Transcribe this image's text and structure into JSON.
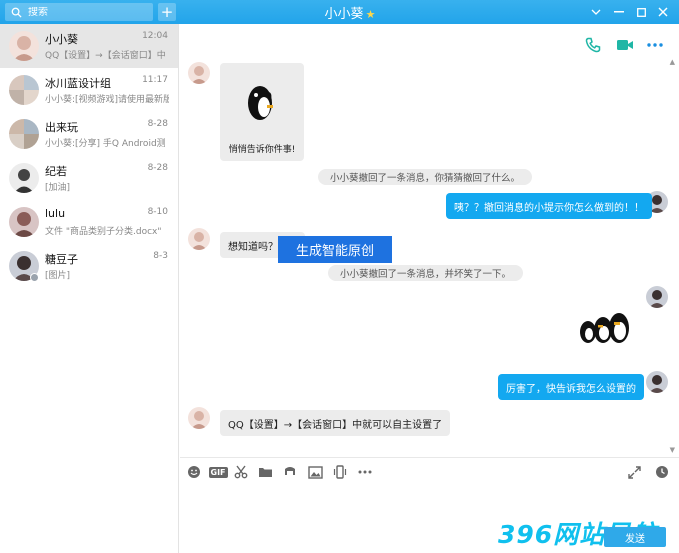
{
  "window": {
    "title": "小小葵",
    "search_placeholder": "搜索",
    "add_label": "+",
    "colors": {
      "titlebar": "#22a4ea",
      "accent": "#13a8f0"
    }
  },
  "contacts": [
    {
      "name": "小小葵",
      "time": "12:04",
      "preview": "QQ【设置】→【会话窗口】中"
    },
    {
      "name": "冰川蓝设计组",
      "time": "11:17",
      "preview": "小小葵:[视频游戏]请使用最新版"
    },
    {
      "name": "出来玩",
      "time": "8-28",
      "preview": "小小葵:[分享] 手Q Android测"
    },
    {
      "name": "纪若",
      "time": "8-28",
      "preview": "[加油]"
    },
    {
      "name": "lulu",
      "time": "8-10",
      "preview": "文件 \"商品类别子分类.docx\""
    },
    {
      "name": "糖豆子",
      "time": "8-3",
      "preview": "[图片]"
    }
  ],
  "messages": {
    "sticker_caption": "悄悄告诉你件事!",
    "sys_recall_1": "小小葵撤回了一条消息，你猜猜撤回了什么。",
    "out_1": "咦？？撤回消息的小提示你怎么做到的！！",
    "watermark": "生成智能原创",
    "in_1": "想知道吗？hhh",
    "sys_recall_2": "小小葵撤回了一条消息，并坏笑了一下。",
    "out_2": "厉害了，快告诉我怎么设置的",
    "in_2": "QQ【设置】→【会话窗口】中就可以自主设置了"
  },
  "toolbar": {
    "gif_label": "GIF"
  },
  "footer": {
    "brand": "396网站导航",
    "send_label": "发送"
  },
  "icons": [
    "search-icon",
    "phone-icon",
    "video-call-icon",
    "more-icon",
    "emoji-icon",
    "gif-icon",
    "scissors-icon",
    "folder-icon",
    "music-icon",
    "image-icon",
    "shake-icon",
    "expand-icon",
    "history-icon"
  ]
}
